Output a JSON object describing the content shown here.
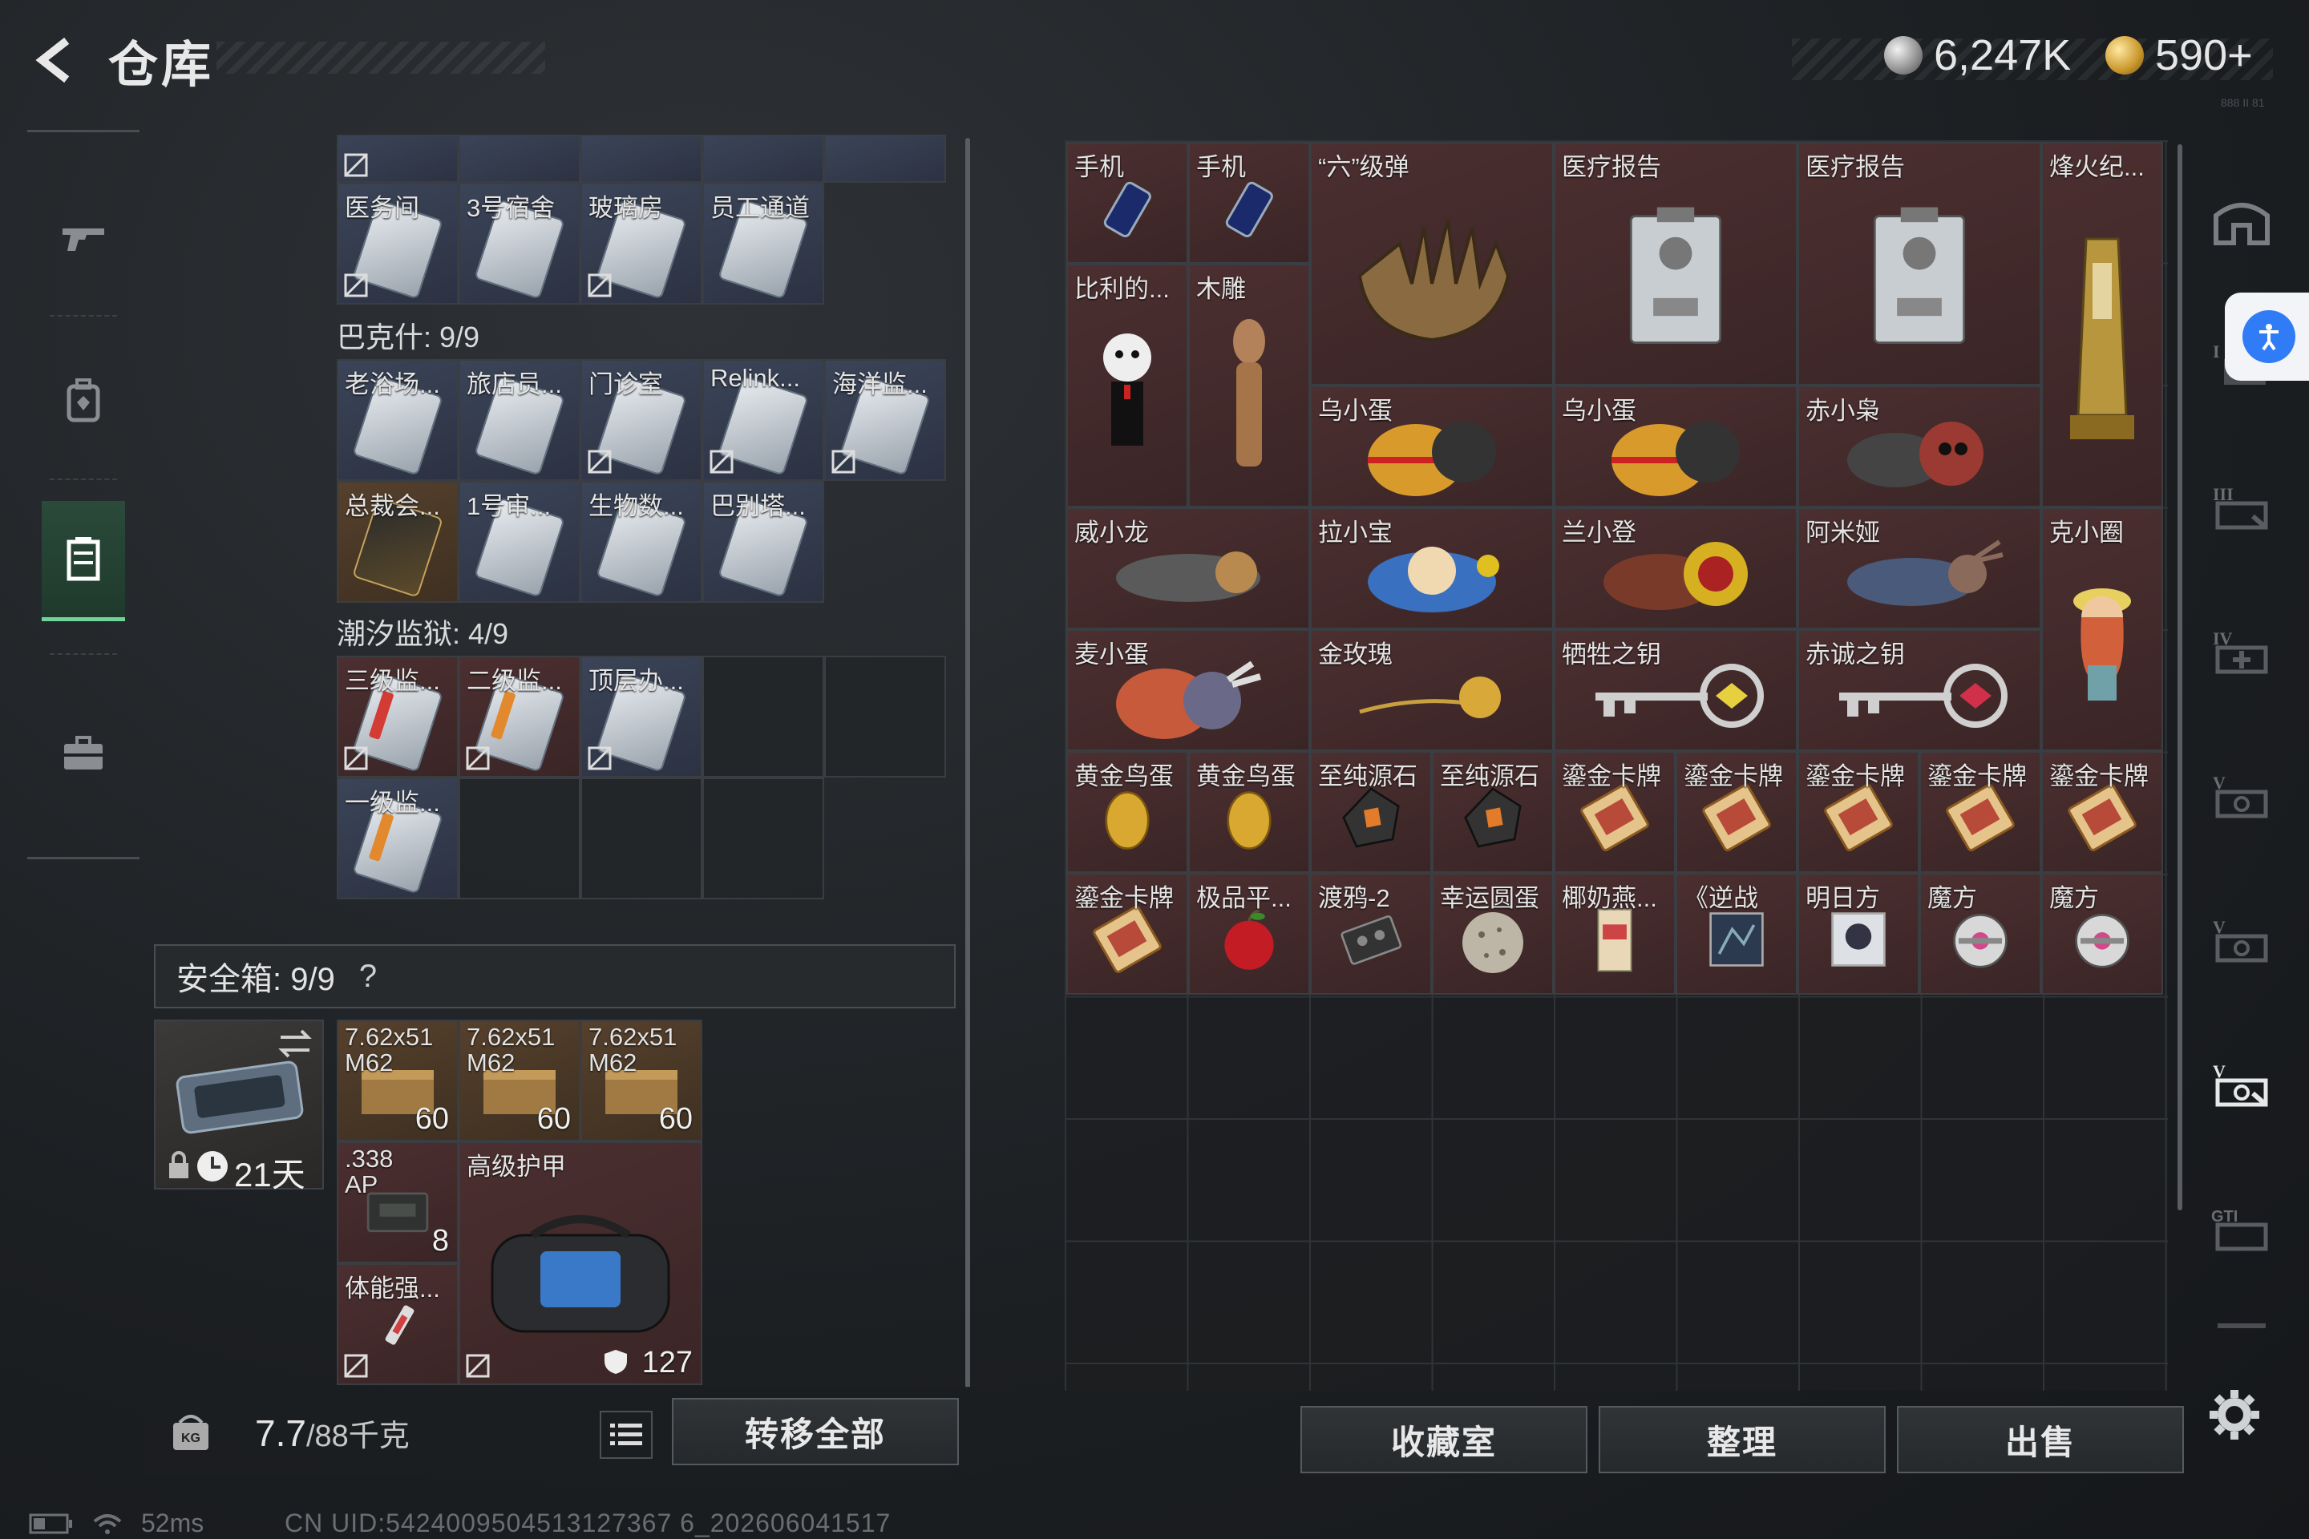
{
  "header": {
    "title": "仓库",
    "silver_amount": "6,247K",
    "gold_amount": "590+",
    "version_tag": "888 II 81"
  },
  "left_nav": {
    "items": [
      {
        "name": "weapon",
        "icon": "gun-icon"
      },
      {
        "name": "backpack",
        "icon": "backpack-icon"
      },
      {
        "name": "storage",
        "icon": "storage-icon",
        "active": true
      },
      {
        "name": "briefcase",
        "icon": "briefcase-icon"
      }
    ]
  },
  "left_grid": {
    "top_row_labels": [
      "医务间",
      "3号宿舍",
      "玻璃房",
      "员工通道"
    ],
    "section_backe": {
      "title": "巴克什: 9/9",
      "row1": [
        "老浴场...",
        "旅店员...",
        "门诊室",
        "Relink...",
        "海洋监..."
      ],
      "row2": [
        "总裁会...",
        "1号审...",
        "生物数...",
        "巴别塔..."
      ]
    },
    "section_tide": {
      "title": "潮汐监狱: 4/9",
      "row1": [
        "三级监...",
        "二级监...",
        "顶层办..."
      ],
      "row2": [
        "一级监..."
      ]
    }
  },
  "safe_box": {
    "title": "安全箱: 9/9",
    "help": "?",
    "case_days": "21天",
    "items": [
      {
        "label": "7.62x51 M62",
        "count": "60"
      },
      {
        "label": "7.62x51 M62",
        "count": "60"
      },
      {
        "label": "7.62x51 M62",
        "count": "60"
      },
      {
        "label": ".338 AP",
        "count": "8"
      },
      {
        "label": "高级护甲",
        "count": "127"
      },
      {
        "label": "体能强..."
      }
    ]
  },
  "bottom": {
    "weight": "7.7",
    "weight_max": "/88千克",
    "transfer_all": "转移全部",
    "collection": "收藏室",
    "organize": "整理",
    "sell": "出售"
  },
  "right_grid": {
    "items": {
      "phone1": "手机",
      "phone2": "手机",
      "six_bullet": "“六”级弹",
      "medical1": "医疗报告",
      "medical2": "医疗报告",
      "beacon": "烽火纪...",
      "billy": "比利的...",
      "carving": "木雕",
      "wu_egg1": "乌小蛋",
      "wu_egg2": "乌小蛋",
      "chi_xiaoniao": "赤小枭",
      "wei_xiaolong": "威小龙",
      "la_xiaobao": "拉小宝",
      "lan_xiaodeng": "兰小登",
      "ami": "阿米娅",
      "ke_xiaoquan": "克小圈",
      "mai_xiaodan": "麦小蛋",
      "gold_rose": "金玫瑰",
      "key_sacrifice": "牺牲之钥",
      "key_loyal": "赤诚之钥",
      "gold_egg1": "黄金鸟蛋",
      "gold_egg2": "黄金鸟蛋",
      "stone1": "至纯源石",
      "stone2": "至纯源石",
      "card1": "鎏金卡牌",
      "card2": "鎏金卡牌",
      "card3": "鎏金卡牌",
      "card4": "鎏金卡牌",
      "card5": "鎏金卡牌",
      "card6": "鎏金卡牌",
      "apple": "极品平...",
      "tape": "渡鸦-2",
      "lucky_egg": "幸运圆蛋",
      "coconut": "椰奶燕...",
      "nizhan": "《逆战",
      "mingri": "明日方",
      "cube1": "魔方",
      "cube2": "魔方"
    }
  },
  "right_tabs": [
    "home-icon",
    "I",
    "II",
    "III",
    "IV",
    "V",
    "V",
    "VI",
    "GTI",
    "more"
  ],
  "status": {
    "ping": "52ms",
    "uid": "CN UID:5424009504513127367 6_202606041517"
  },
  "colors": {
    "accent_green": "#6fd39a",
    "access_blue": "#2f7cf6"
  }
}
